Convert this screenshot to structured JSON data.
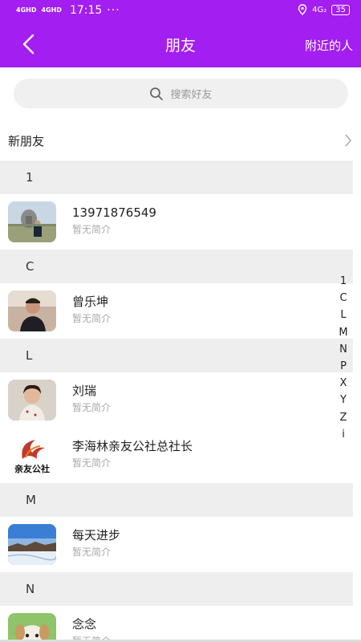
{
  "status_bar": {
    "network1": "4GHD",
    "network2": "4GHD",
    "time": "17:15",
    "dots": "···",
    "network_right": "4G₂",
    "battery": "35"
  },
  "header": {
    "title": "朋友",
    "right_label": "附近的人",
    "color": "#a31ef0"
  },
  "search": {
    "placeholder": "搜索好友"
  },
  "new_friends": {
    "label": "新朋友"
  },
  "sections": [
    {
      "letter": "1",
      "items": [
        {
          "name": "13971876549",
          "intro": "暂无简介"
        }
      ]
    },
    {
      "letter": "C",
      "items": [
        {
          "name": "曾乐坤",
          "intro": "暂无简介"
        }
      ]
    },
    {
      "letter": "L",
      "items": [
        {
          "name": "刘瑞",
          "intro": "暂无简介"
        },
        {
          "name": "李海林亲友公社总社长",
          "intro": "暂无简介"
        }
      ]
    },
    {
      "letter": "M",
      "items": [
        {
          "name": "每天进步",
          "intro": "暂无简介"
        }
      ]
    },
    {
      "letter": "N",
      "items": [
        {
          "name": "念念",
          "intro": "暂无简介"
        }
      ]
    }
  ],
  "logo_text": "亲友公社",
  "index_letters": [
    "1",
    "C",
    "L",
    "M",
    "N",
    "P",
    "X",
    "Y",
    "Z",
    "i"
  ]
}
